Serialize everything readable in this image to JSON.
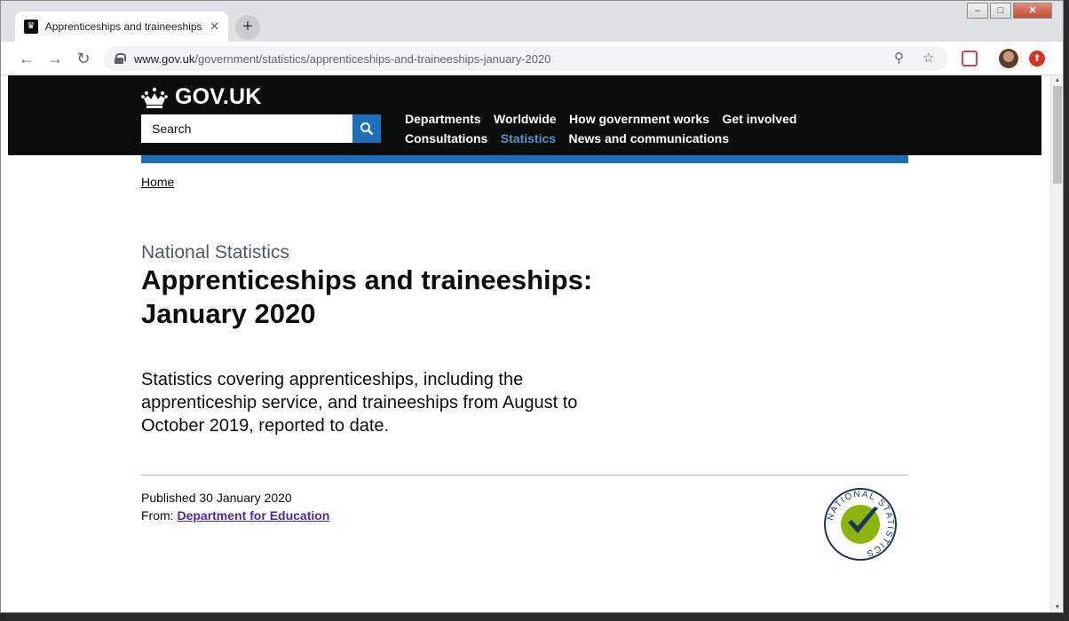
{
  "browser": {
    "tab_title": "Apprenticeships and traineeships",
    "tab_close": "✕",
    "new_tab": "+",
    "url_domain": "www.gov.uk",
    "url_path": "/government/statistics/apprenticeships-and-traineeships-january-2020"
  },
  "header": {
    "logo_text": "GOV.UK",
    "search_placeholder": "Search",
    "nav": [
      {
        "label": "Departments"
      },
      {
        "label": "Worldwide"
      },
      {
        "label": "How government works"
      },
      {
        "label": "Get involved"
      },
      {
        "label": "Consultations"
      },
      {
        "label": "Statistics",
        "active": true
      },
      {
        "label": "News and communications"
      }
    ]
  },
  "breadcrumb": {
    "home": "Home"
  },
  "main": {
    "caption": "National Statistics",
    "title_line1": "Apprenticeships and traineeships:",
    "title_line2": "January 2020",
    "summary": "Statistics covering apprenticeships, including the apprenticeship service, and traineeships from August to October 2019, reported to date.",
    "published": "Published 30 January 2020",
    "from_label": "From:",
    "from_link": "Department for Education",
    "badge_text": "NATIONAL STATISTICS"
  },
  "colors": {
    "gov_black": "#0b0c0c",
    "gov_blue": "#1d70b8",
    "active_nav": "#5694ca",
    "link_visited": "#4c2c92",
    "badge_green": "#8cb40f",
    "badge_navy": "#1b365d"
  },
  "icons": [
    "crown-icon",
    "search-icon",
    "lock-icon",
    "zoom-icon",
    "star-icon",
    "national-statistics-badge-icon"
  ]
}
